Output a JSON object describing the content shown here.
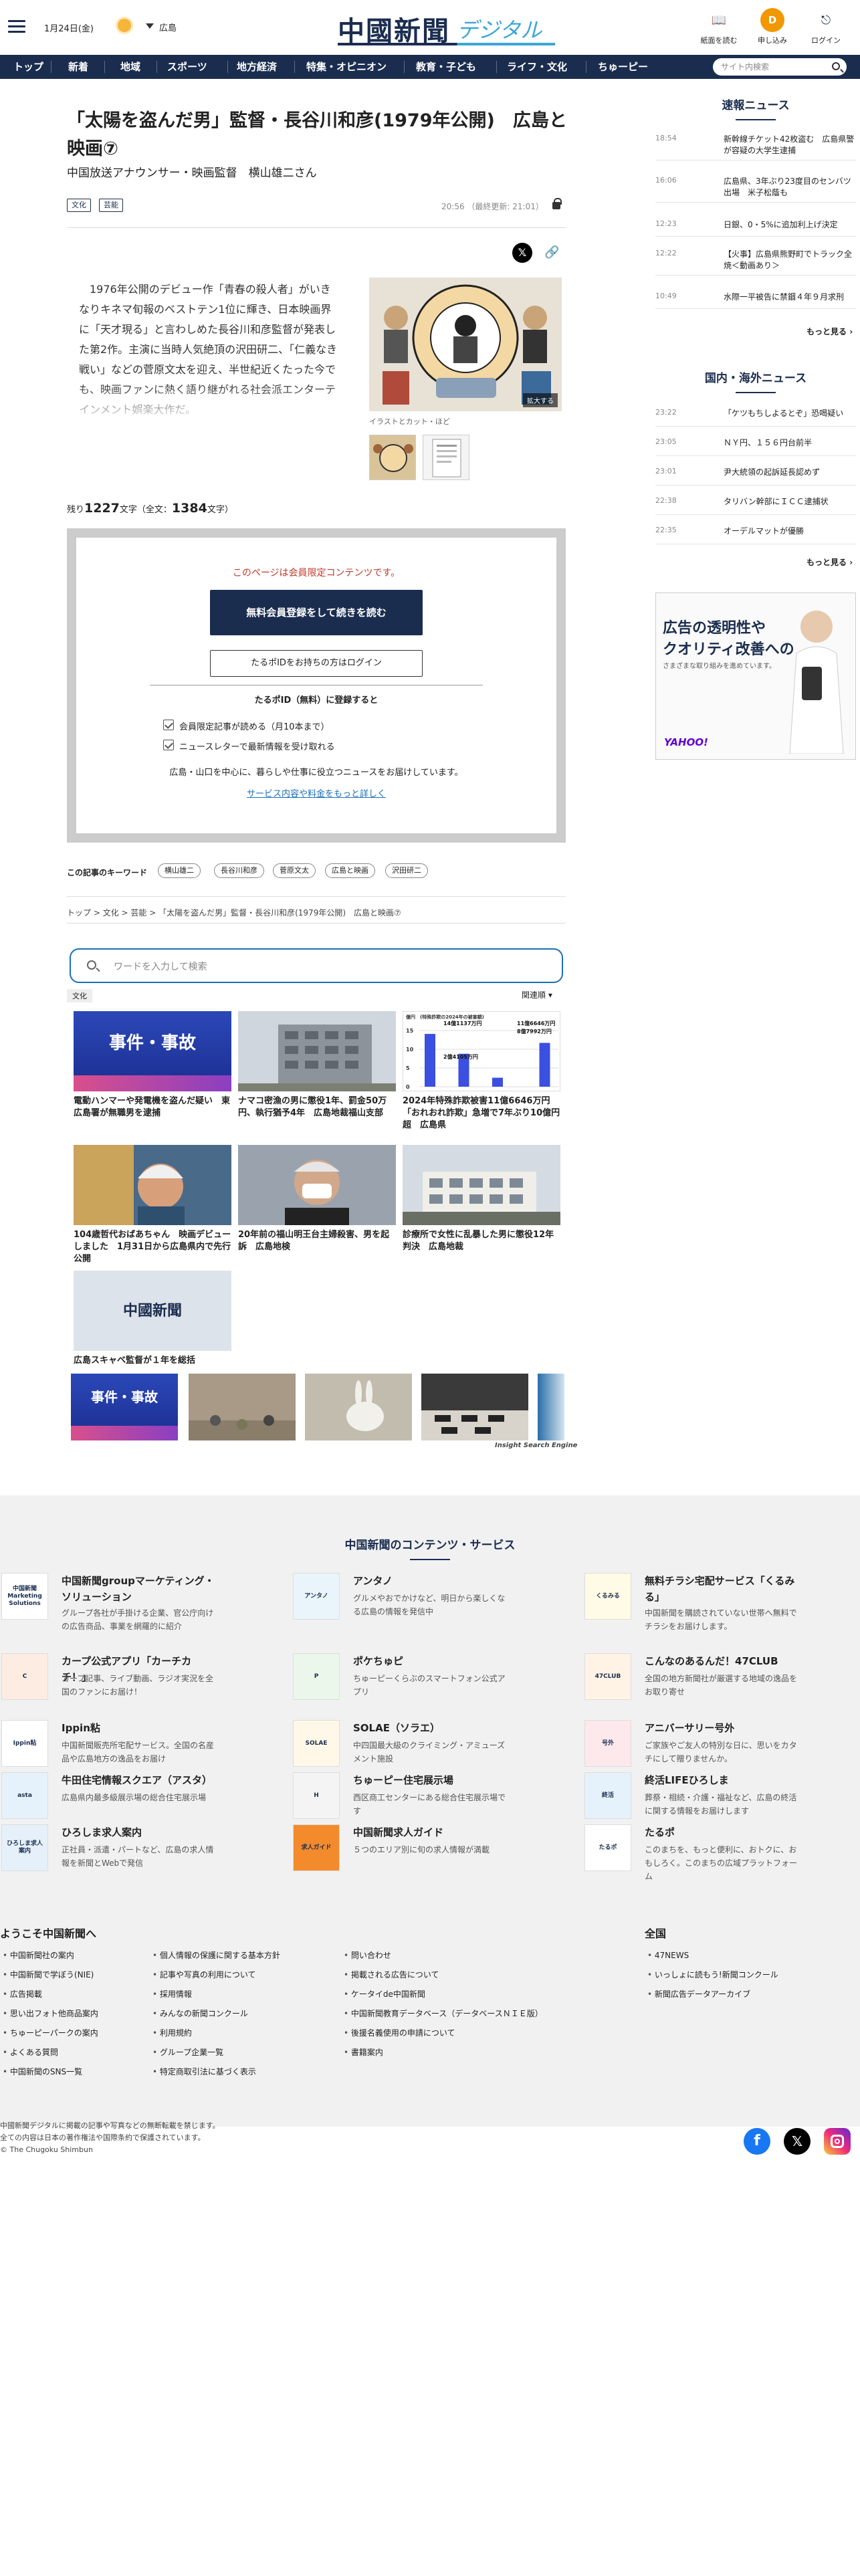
{
  "header": {
    "date": "1月24日(金)",
    "region": "広島",
    "logo_main": "中國新聞",
    "logo_sub": "デジタル",
    "buttons": {
      "paper": "紙面を読む",
      "signup": "申し込み",
      "login": "ログイン",
      "signup_badge": "D"
    }
  },
  "nav": {
    "items": [
      "トップ",
      "新着",
      "地域",
      "スポーツ",
      "地方経済",
      "特集・オピニオン",
      "教育・子ども",
      "ライフ・文化",
      "ちゅーピー"
    ],
    "search_placeholder": "サイト内検索"
  },
  "article": {
    "title": "「太陽を盗んだ男」監督・長谷川和彦(1979年公開)　広島と映画⑦",
    "subtitle": "中国放送アナウンサー・映画監督　横山雄二さん",
    "tags": [
      "文化",
      "芸能"
    ],
    "timestamp": "20:56 （最終更新: 21:01）",
    "body": "　1976年公開のデビュー作「青春の殺人者」がいきなりキネマ旬報のベストテン1位に輝き、日本映画界に「天才現る」と言わしめた長谷川和彦監督が発表した第2作。主演に当時人気絶頂の沢田研二、「仁義なき戦い」などの菅原文太を迎え、半世紀近くたった今でも、映画ファンに熱く語り継がれる社会派エンターテインメント娯楽大作だ。",
    "image_caption": "イラストとカット・ほど",
    "enlarge": "拡大する",
    "remaining_label_pre": "残り",
    "remaining_count": "1227",
    "remaining_label_mid": "文字（全文：",
    "total_count": "1384",
    "remaining_label_post": "文字）"
  },
  "paywall": {
    "notice": "このページは会員限定コンテンツです。",
    "register_btn": "無料会員登録をして続きを読む",
    "login_btn": "たるポIDをお持ちの方はログイン",
    "heading": "たるポID（無料）に登録すると",
    "benefits": [
      "会員限定記事が読める（月10本まで）",
      "ニュースレターで最新情報を受け取れる"
    ],
    "desc": "広島・山口を中心に、暮らしや仕事に役立つニュースをお届けしています。",
    "link": "サービス内容や料金をもっと詳しく"
  },
  "keywords": {
    "label": "この記事のキーワード",
    "items": [
      "横山雄二",
      "長谷川和彦",
      "菅原文太",
      "広島と映画",
      "沢田研二"
    ]
  },
  "breadcrumb": [
    "トップ",
    "文化",
    "芸能",
    "「太陽を盗んだ男」監督・長谷川和彦(1979年公開)　広島と映画⑦"
  ],
  "inline_search": {
    "placeholder": "ワードを入力して検索",
    "category": "文化",
    "sort": "関連順"
  },
  "cards": [
    {
      "img_label": "事件・事故",
      "title": "電動ハンマーや発電機を盗んだ疑い　東広島署が無職男を逮捕"
    },
    {
      "img_label": "",
      "title": "ナマコ密漁の男に懲役1年、罰金50万円、執行猶予4年　広島地裁福山支部"
    },
    {
      "img_label": "",
      "title": "2024年特殊詐欺被害11億6646万円　「おれおれ詐欺」急増で7年ぶり10億円超　広島県"
    },
    {
      "img_label": "",
      "title": "104歳哲代おばあちゃん　映画デビューしました　1月31日から広島県内で先行公開"
    },
    {
      "img_label": "",
      "title": "20年前の福山明王台主婦殺害、男を起訴　広島地検"
    },
    {
      "img_label": "",
      "title": "診療所で女性に乱暴した男に懲役12年判決　広島地裁"
    },
    {
      "img_label": "中國新聞",
      "title": "広島スキャベ監督が１年を総括"
    }
  ],
  "card_chart": {
    "labels": [
      "14億1137万円",
      "11億6646万円",
      "8億7992万円",
      "2億4105万円"
    ],
    "title": "億円　(特殊詐欺の2024年の被害額)",
    "values": [
      14.1,
      8.8,
      2.4,
      11.7
    ],
    "ymax": 15
  },
  "strip_label": "事件・事故",
  "insight": "Insight Search Engine",
  "sidebar": {
    "breaking_title": "速報ニュース",
    "breaking": [
      {
        "time": "18:54",
        "title": "新幹線チケット42枚盗む　広島県警が容疑の大学生逮捕"
      },
      {
        "time": "16:06",
        "title": "広島県、3年ぶり23度目のセンバツ出場　米子松蔭も"
      },
      {
        "time": "12:23",
        "title": "日銀、0・5%に追加利上げ決定"
      },
      {
        "time": "12:22",
        "title": "【火事】広島県熊野町でトラック全焼＜動画あり＞"
      },
      {
        "time": "10:49",
        "title": "水際一平被告に禁錮４年９月求刑"
      }
    ],
    "more": "もっと見る",
    "intl_title": "国内・海外ニュース",
    "intl": [
      {
        "time": "23:22",
        "title": "「ケツもちしよるとぞ」恐喝疑い"
      },
      {
        "time": "23:05",
        "title": "ＮＹ円、１５６円台前半"
      },
      {
        "time": "23:01",
        "title": "尹大統領の起訴延長認めず"
      },
      {
        "time": "22:38",
        "title": "タリバン幹部にＩＣＣ逮捕状"
      },
      {
        "time": "22:35",
        "title": "オーデルマットが優勝"
      }
    ],
    "ad": {
      "line1": "広告の透明性や",
      "line2": "クオリティ改善への",
      "line3": "さまざまな取り組みを進めています。",
      "brand": "YAHOO!"
    }
  },
  "footer": {
    "services_title": "中国新聞のコンテンツ・サービス",
    "services": [
      {
        "name": "中国新聞groupマーケティング・ソリューション",
        "desc": "グループ各社が手掛ける企業、官公庁向けの広告商品、事業を網羅的に紹介",
        "logo": "中国新聞 Marketing Solutions"
      },
      {
        "name": "アンタノ",
        "desc": "グルメやおでかけなど、明日から楽しくなる広島の情報を発信中",
        "logo": "アンタノ"
      },
      {
        "name": "無料チラシ宅配サービス「くるみる」",
        "desc": "中国新聞を購読されていない世帯へ無料でチラシをお届けします。",
        "logo": "くるみる"
      },
      {
        "name": "カープ公式アプリ「カーチカチ！」",
        "desc": "カープ記事、ライブ動画、ラジオ実況を全国のファンにお届け！",
        "logo": "C"
      },
      {
        "name": "ポケちゅピ",
        "desc": "ちゅーピーくらぶのスマートフォン公式アプリ",
        "logo": "P"
      },
      {
        "name": "こんなのあるんだ！47CLUB",
        "desc": "全国の地方新聞社が厳選する地域の逸品をお取り寄せ",
        "logo": "47CLUB"
      },
      {
        "name": "Ippin粘",
        "desc": "中国新聞販売所宅配サービス。全国の名産品や広島地方の逸品をお届け",
        "logo": "Ippin粘"
      },
      {
        "name": "SOLAE（ソラエ）",
        "desc": "中四国最大級のクライミング・アミューズメント施設",
        "logo": "SOLAE"
      },
      {
        "name": "アニバーサリー号外",
        "desc": "ご家族やご友人の特別な日に、思いをカタチにして贈りませんか。",
        "logo": "号外"
      },
      {
        "name": "牛田住宅情報スクエア（アスタ）",
        "desc": "広島県内最多級展示場の総合住宅展示場",
        "logo": "asta"
      },
      {
        "name": "ちゅーピー住宅展示場",
        "desc": "西区商工センターにある総合住宅展示場です",
        "logo": "H"
      },
      {
        "name": "終活LIFEひろしま",
        "desc": "葬祭・相続・介護・福祉など、広島の終活に関する情報をお届けします",
        "logo": "終活"
      },
      {
        "name": "ひろしま求人案内",
        "desc": "正社員・派遣・パートなど、広島の求人情報を新聞とWebで発信",
        "logo": "ひろしま求人案内"
      },
      {
        "name": "中国新聞求人ガイド",
        "desc": "５つのエリア別に旬の求人情報が満載",
        "logo": "求人ガイド"
      },
      {
        "name": "たるポ",
        "desc": "このまちを、もっと便利に、おトクに、おもしろく。このまちの広域プラットフォーム",
        "logo": "たるポ"
      }
    ],
    "welcome_title": "ようこそ中国新聞へ",
    "col1": [
      "中国新聞社の案内",
      "中国新聞で学ぼう(NIE)",
      "広告掲載",
      "思い出フォト他商品案内",
      "ちゅーピーパークの案内",
      "よくある質問",
      "中国新聞のSNS一覧"
    ],
    "col2": [
      "個人情報の保護に関する基本方針",
      "記事や写真の利用について",
      "採用情報",
      "みんなの新聞コンクール",
      "利用規約",
      "グループ企業一覧",
      "特定商取引法に基づく表示"
    ],
    "col3": [
      "問い合わせ",
      "掲載される広告について",
      "ケータイde中国新聞",
      "中国新聞教育データベース（データベースＮＩＥ版）",
      "後援名義使用の申請について",
      "書籍案内"
    ],
    "nation_title": "全国",
    "col4": [
      "47NEWS",
      "いっしょに読もう!新聞コンクール",
      "新聞広告データアーカイブ"
    ],
    "copyright": [
      "中國新聞デジタルに掲載の記事や写真などの無断転載を禁じます。",
      "全ての内容は日本の著作権法や国際条約で保護されています。",
      "© The Chugoku Shimbun"
    ]
  },
  "colors": {
    "navy": "#1b2d4f",
    "accent": "#3aa7d8",
    "orange": "#f19800",
    "red": "#c0392b"
  }
}
